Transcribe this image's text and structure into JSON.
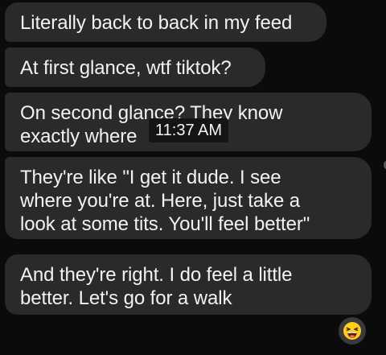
{
  "messages": [
    {
      "lines": [
        "Literally back to back in my feed"
      ]
    },
    {
      "lines": [
        "At first glance, wtf tiktok?"
      ]
    },
    {
      "lines": [
        "On second glance? They know",
        "exactly where"
      ]
    },
    {
      "lines": [
        "They're like \"I get it dude. I see",
        "where you're at. Here, just take a",
        "look at some tits. You'll feel better\""
      ]
    },
    {
      "lines": [
        "And they're right. I do feel a little",
        "better. Let's go for a walk"
      ]
    }
  ],
  "timestamp": "11:37 AM",
  "reaction": {
    "icon": "laughing-emoji-icon"
  },
  "colors": {
    "background": "#0b0b0c",
    "bubble": "#2a2a2c",
    "text": "#f2f2f4",
    "timestamp_bg": "#151516",
    "reaction_bg": "#3a3a3d",
    "emoji_yellow": "#ffcc22"
  }
}
